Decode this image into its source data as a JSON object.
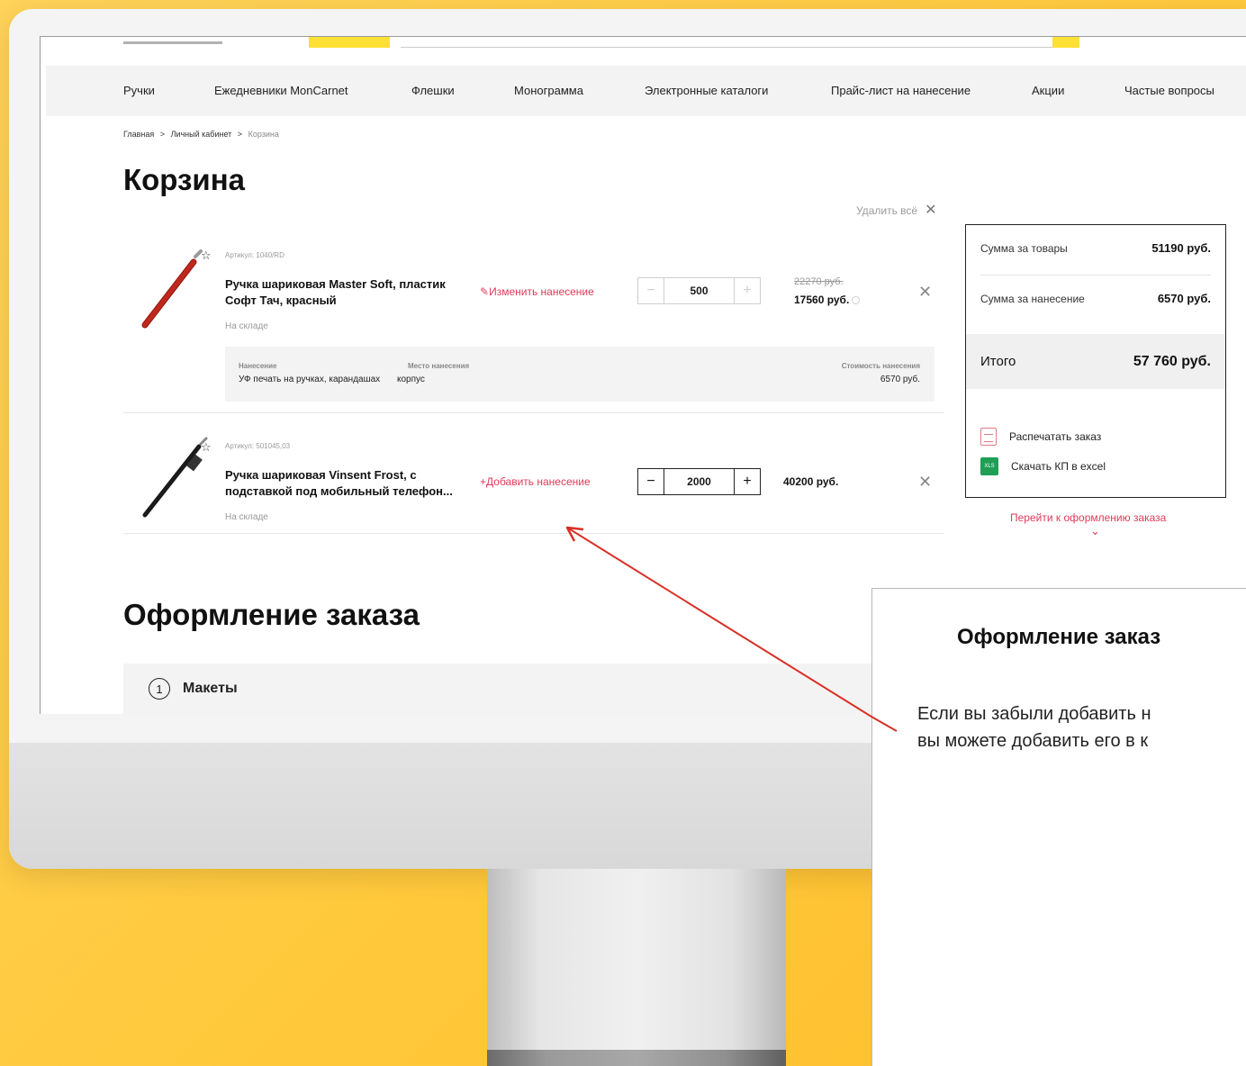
{
  "nav": {
    "items": [
      "Ручки",
      "Ежедневники MonCarnet",
      "Флешки",
      "Монограмма",
      "Электронные каталоги",
      "Прайс-лист на нанесение",
      "Акции",
      "Частые вопросы"
    ]
  },
  "breadcrumb": {
    "home": "Главная",
    "sep": ">",
    "account": "Личный кабинет",
    "current": "Корзина"
  },
  "cart": {
    "title": "Корзина",
    "delete_all": "Удалить всё",
    "items": [
      {
        "sku": "Артикул: 1040/RD",
        "name": "Ручка шариковая Master Soft, пластик Софт Тач, красный",
        "stock": "На складе",
        "print_action": "Изменить нанесение",
        "qty": "500",
        "old_price": "22270 руб.",
        "price": "17560 руб.",
        "pen_color": "#c0271d",
        "print": {
          "h_print": "Нанесение",
          "h_place": "Место нанесения",
          "h_cost": "Стоимость нанесения",
          "v_print": "УФ печать на ручках, карандашах",
          "v_place": "корпус",
          "v_cost": "6570 руб."
        }
      },
      {
        "sku": "Артикул: 501045,03",
        "name": "Ручка шариковая Vinsent Frost, с подставкой под мобильный телефон...",
        "stock": "На складе",
        "print_action": "+Добавить нанесение",
        "qty": "2000",
        "price": "40200 руб.",
        "pen_color": "#1b1b1b"
      }
    ]
  },
  "summary": {
    "goods_label": "Сумма за товары",
    "goods_value": "51190 руб.",
    "print_label": "Сумма за нанесение",
    "print_value": "6570 руб.",
    "total_label": "Итого",
    "total_value": "57 760 руб.",
    "print_order": "Распечатать заказ",
    "download_excel": "Скачать КП в excel",
    "xls_badge": "XLS",
    "checkout_link": "Перейти к оформлению заказа"
  },
  "checkout": {
    "title": "Оформление заказа",
    "step_number": "1",
    "step_label": "Макеты"
  },
  "callout": {
    "title": "Оформление заказ",
    "text_line1": "Если вы забыли добавить н",
    "text_line2": "вы можете добавить его в к"
  },
  "colors": {
    "accent_red": "#e03a5a",
    "background_yellow": "#ffc93c",
    "brand_yellow": "#ffe033",
    "arrow_red": "#d93025"
  }
}
